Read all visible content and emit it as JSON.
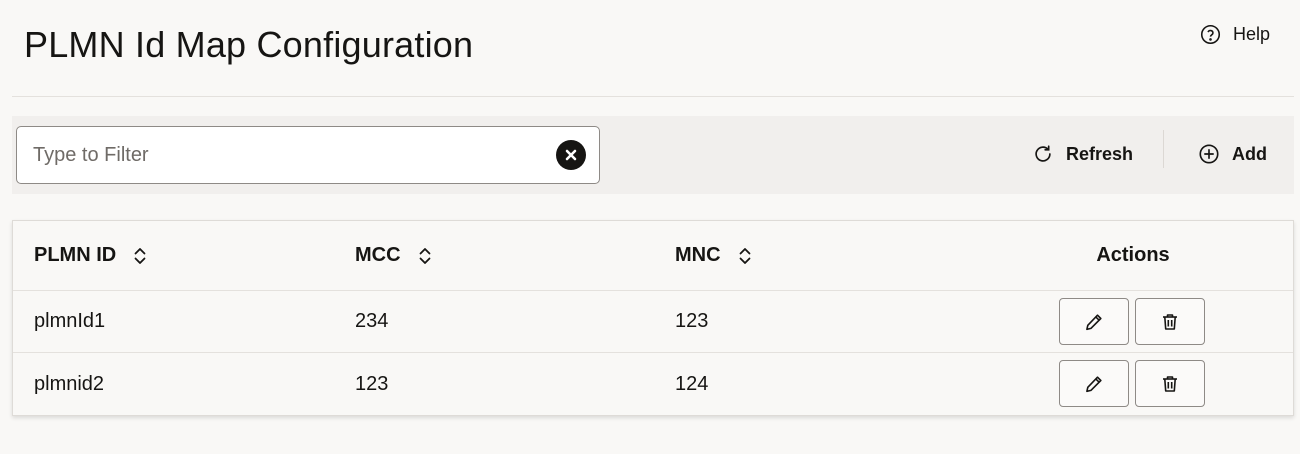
{
  "header": {
    "title": "PLMN Id Map Configuration",
    "help_label": "Help"
  },
  "toolbar": {
    "filter_placeholder": "Type to Filter",
    "filter_value": "",
    "refresh_label": "Refresh",
    "add_label": "Add"
  },
  "table": {
    "columns": [
      {
        "label": "PLMN ID",
        "sortable": true
      },
      {
        "label": "MCC",
        "sortable": true
      },
      {
        "label": "MNC",
        "sortable": true
      },
      {
        "label": "Actions",
        "sortable": false
      }
    ],
    "rows": [
      {
        "plmn_id": "plmnId1",
        "mcc": "234",
        "mnc": "123"
      },
      {
        "plmn_id": "plmnid2",
        "mcc": "123",
        "mnc": "124"
      }
    ]
  },
  "icons": {
    "help": "help-circle-icon",
    "clear": "clear-circle-icon",
    "refresh": "refresh-icon",
    "add": "add-circle-icon",
    "sort": "sort-icon",
    "edit": "pencil-icon",
    "delete": "trash-icon"
  }
}
